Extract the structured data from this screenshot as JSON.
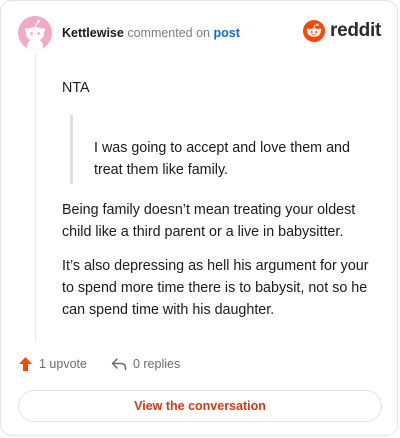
{
  "comment": {
    "author": "Kettlewise",
    "action_text": "commented on",
    "post_link": "post"
  },
  "brand": {
    "name": "reddit",
    "icon": "reddit-alien-icon",
    "color": "#ff4500"
  },
  "content": {
    "opening": "NTA",
    "quote": "I was going to accept and love them and treat them like family.",
    "paragraph_1": "Being family doesn’t mean treating your oldest child like a third parent or a live in babysitter.",
    "paragraph_2": "It’s also depressing as hell his argument for your to spend more time there is to babysit, not so he can spend time with his daughter."
  },
  "footer": {
    "upvotes_label": "1 upvote",
    "replies_label": "0 replies",
    "upvote_icon": "upvote-arrow-icon",
    "reply_icon": "reply-arrow-icon"
  },
  "cta": {
    "label": "View the conversation"
  },
  "colors": {
    "accent": "#d43a10",
    "link": "#0b6bd6",
    "avatar_bg": "#f2a9c4"
  }
}
